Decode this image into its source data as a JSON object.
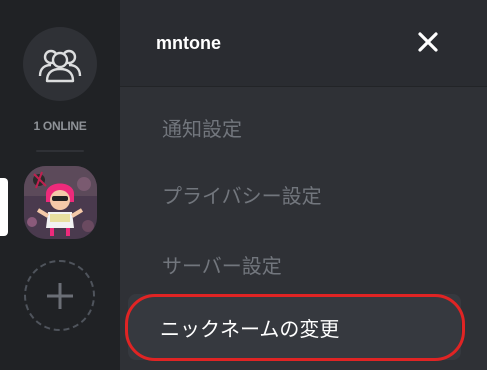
{
  "rail": {
    "friends_icon": "friends-icon",
    "online_count": "1 ONLINE",
    "add_server_icon": "plus-icon"
  },
  "panel": {
    "server_name": "mntone",
    "close_icon": "close-icon",
    "items": [
      {
        "label": "通知設定"
      },
      {
        "label": "プライバシー設定"
      },
      {
        "label": "サーバー設定"
      },
      {
        "label": "ニックネームの変更",
        "active": true
      }
    ]
  },
  "colors": {
    "rail_bg": "#202225",
    "panel_bg": "#2f3136",
    "header_bg": "#2a2c31",
    "muted_text": "#72767d",
    "active_text": "#ffffff",
    "annotation": "#e02424"
  }
}
